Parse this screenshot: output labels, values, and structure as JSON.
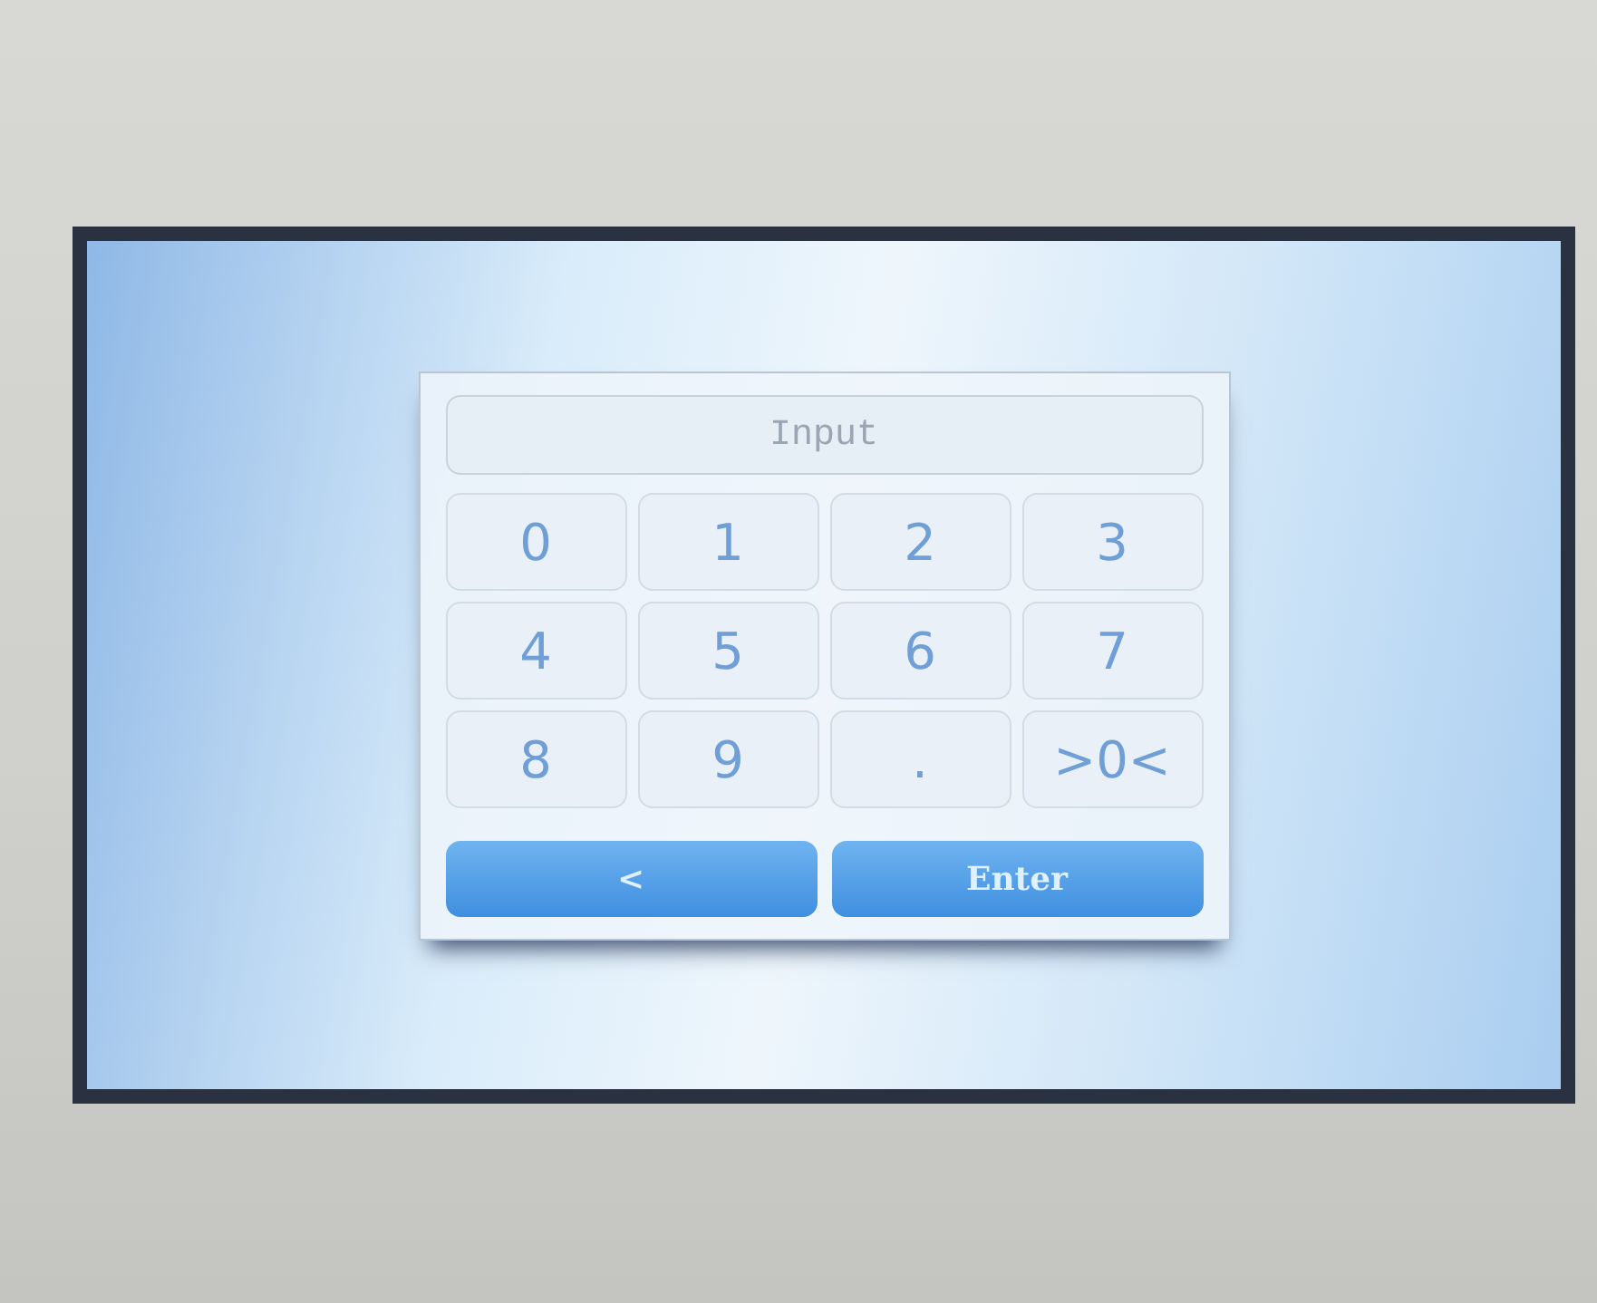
{
  "input": {
    "placeholder": "Input"
  },
  "keys": [
    "0",
    "1",
    "2",
    "3",
    "4",
    "5",
    "6",
    "7",
    "8",
    "9",
    ".",
    ">0<"
  ],
  "actions": [
    {
      "label": "<"
    },
    {
      "label": "Enter"
    }
  ]
}
